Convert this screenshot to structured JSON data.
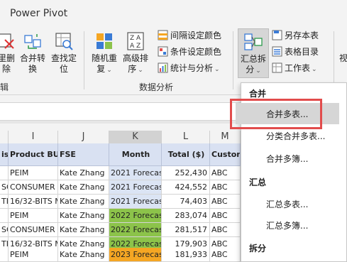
{
  "ribbon": {
    "tab_power_pivot": "Power Pivot",
    "partial_left_top": "里删",
    "partial_left_bottom": "除",
    "merge_convert_top": "合并转",
    "merge_convert_bottom": "换",
    "find_locate_top": "查找定",
    "find_locate_bottom": "位",
    "random_top": "随机重",
    "random_bottom": "复",
    "advanced_sort_top": "高级排",
    "advanced_sort_bottom": "序",
    "interval_color": "间隔设定颜色",
    "conditional_color": "条件设定颜色",
    "stats_analysis": "统计与分析",
    "summarize_split_top": "汇总拆",
    "summarize_split_bottom": "分",
    "save_as_sheet": "另存本表",
    "sheet_catalog": "表格目录",
    "worksheet": "工作表",
    "partial_right": "视",
    "group_edit_partial": "辑",
    "group_data_analysis": "数据分析"
  },
  "columns": [
    "I",
    "J",
    "K",
    "L",
    "M"
  ],
  "headers": {
    "partial_left": "is",
    "product_bu": "Product BU",
    "fse": "FSE",
    "month": "Month",
    "total": "Total ($)",
    "customer_partial": "Custon"
  },
  "rows": [
    {
      "prefix": "",
      "product_bu": "PEIM",
      "fse": "Kate Zhang",
      "month": "2021 Forecast",
      "total": "252,430",
      "customer": "ABC",
      "month_color": "#dbe4f4"
    },
    {
      "prefix": "SC",
      "product_bu": "CONSUMER M",
      "fse": "Kate Zhang",
      "month": "2021 Forecast",
      "total": "424,552",
      "customer": "ABC",
      "month_color": "#dbe4f4"
    },
    {
      "prefix": "TI",
      "product_bu": "16/32-BITS M",
      "fse": "Kate Zhang",
      "month": "2021 Forecast",
      "total": "74,403",
      "customer": "ABC",
      "month_color": "#dbe4f4"
    },
    {
      "prefix": "",
      "product_bu": "PEIM",
      "fse": "Kate Zhang",
      "month": "2022 Forecast",
      "total": "283,074",
      "customer": "ABC",
      "month_color": "#8cc34a"
    },
    {
      "prefix": "SC",
      "product_bu": "CONSUMER M",
      "fse": "Kate Zhang",
      "month": "2022 Forecast",
      "total": "281,517",
      "customer": "ABC",
      "month_color": "#8cc34a"
    },
    {
      "prefix": "TI",
      "product_bu": "16/32-BITS M",
      "fse": "Kate Zhang",
      "month": "2022 Forecast",
      "total": "179,903",
      "customer": "ABC",
      "month_color": "#8cc34a"
    },
    {
      "prefix": "",
      "product_bu": "PEIM",
      "fse": "Kate Zhang",
      "month": "2023 Forecast",
      "total": "181,933",
      "customer": "ABC",
      "month_color": "#f5a623"
    }
  ],
  "dropdown": {
    "section_merge": "合并",
    "merge_multi_sheets": "合并多表...",
    "category_merge": "分类合并多表...",
    "merge_multi_books": "合并多簿...",
    "section_summary": "汇总",
    "summary_multi_sheets": "汇总多表...",
    "summary_multi_books": "汇总多簿...",
    "section_split": "拆分"
  },
  "colors": {
    "header_fill": "#d9e1f2",
    "forecast_2021": "#dbe4f4",
    "forecast_2022": "#8cc34a",
    "forecast_2023": "#f5a623",
    "highlight_border": "#e24c4c"
  }
}
